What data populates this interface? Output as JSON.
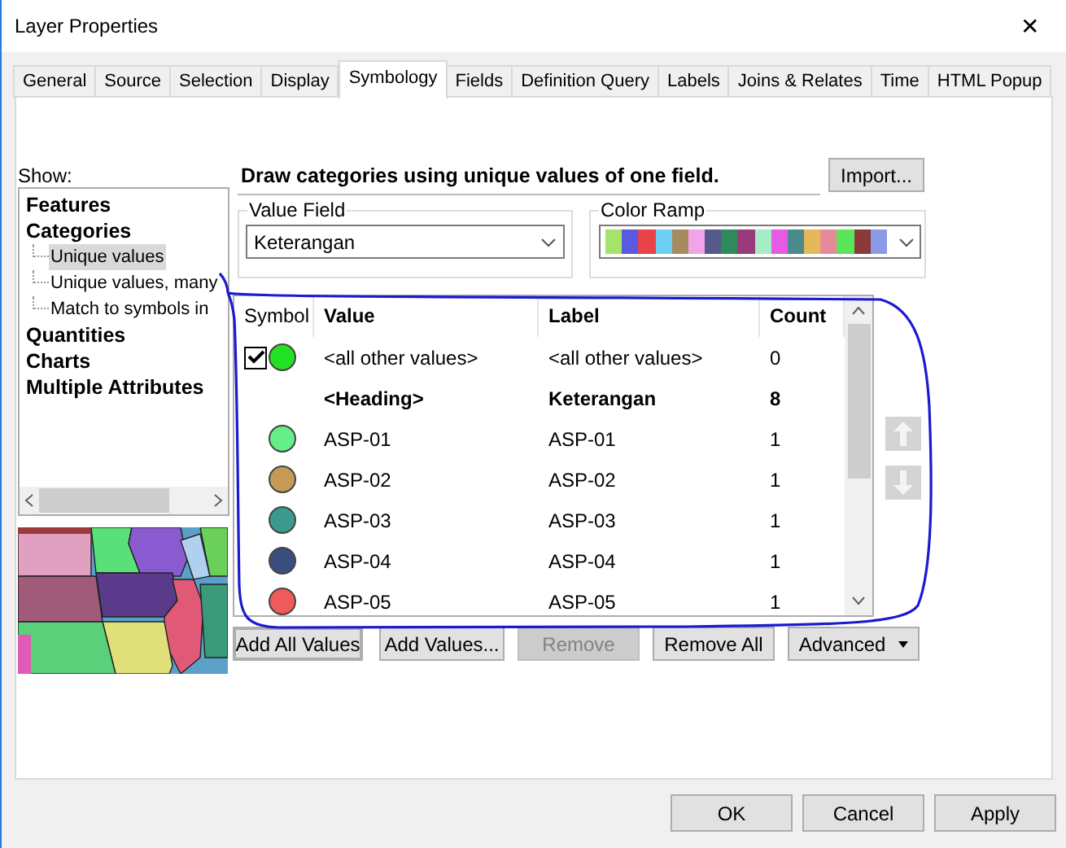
{
  "window": {
    "title": "Layer Properties",
    "close": "✕"
  },
  "tabs": [
    {
      "label": "General",
      "selected": false
    },
    {
      "label": "Source",
      "selected": false
    },
    {
      "label": "Selection",
      "selected": false
    },
    {
      "label": "Display",
      "selected": false
    },
    {
      "label": "Symbology",
      "selected": true
    },
    {
      "label": "Fields",
      "selected": false
    },
    {
      "label": "Definition Query",
      "selected": false
    },
    {
      "label": "Labels",
      "selected": false
    },
    {
      "label": "Joins & Relates",
      "selected": false
    },
    {
      "label": "Time",
      "selected": false
    },
    {
      "label": "HTML Popup",
      "selected": false
    }
  ],
  "show": {
    "label": "Show:",
    "items": [
      {
        "label": "Features",
        "selected": false
      },
      {
        "label": "Categories",
        "selected": false,
        "children": [
          {
            "label": "Unique values",
            "selected": true
          },
          {
            "label": "Unique values, many",
            "selected": false
          },
          {
            "label": "Match to symbols in",
            "selected": false
          }
        ]
      },
      {
        "label": "Quantities",
        "selected": false
      },
      {
        "label": "Charts",
        "selected": false
      },
      {
        "label": "Multiple Attributes",
        "selected": false
      }
    ]
  },
  "description": "Draw categories using unique values of one field.",
  "import_button": "Import...",
  "value_field": {
    "label": "Value Field",
    "value": "Keterangan"
  },
  "color_ramp": {
    "label": "Color Ramp",
    "swatches": [
      {
        "color": "#a6e36a"
      },
      {
        "color": "#5a5ae0"
      },
      {
        "color": "#e8434a"
      },
      {
        "color": "#6ecff5"
      },
      {
        "color": "#a88a60"
      },
      {
        "color": "#f3a4e8"
      },
      {
        "color": "#555a8a"
      },
      {
        "color": "#2e8a5a"
      },
      {
        "color": "#9a3a7a"
      },
      {
        "color": "#a6ecc6"
      },
      {
        "color": "#e65ae6"
      },
      {
        "color": "#4a8a8a"
      },
      {
        "color": "#e6b85a"
      },
      {
        "color": "#e68a9a"
      },
      {
        "color": "#5ae65a"
      },
      {
        "color": "#8a3a3a"
      },
      {
        "color": "#8a9ae6"
      }
    ]
  },
  "table": {
    "columns": [
      "Symbol",
      "Value",
      "Label",
      "Count"
    ],
    "rows": [
      {
        "kind": "other",
        "checked": true,
        "color": "#22e022",
        "value": "<all other values>",
        "label": "<all other values>",
        "count": "0"
      },
      {
        "kind": "heading",
        "value": "<Heading>",
        "label": "Keterangan",
        "count": "8"
      },
      {
        "kind": "value",
        "color": "#66ee88",
        "value": "ASP-01",
        "label": "ASP-01",
        "count": "1"
      },
      {
        "kind": "value",
        "color": "#c49a55",
        "value": "ASP-02",
        "label": "ASP-02",
        "count": "1"
      },
      {
        "kind": "value",
        "color": "#3a9a90",
        "value": "ASP-03",
        "label": "ASP-03",
        "count": "1"
      },
      {
        "kind": "value",
        "color": "#3a4e80",
        "value": "ASP-04",
        "label": "ASP-04",
        "count": "1"
      },
      {
        "kind": "value",
        "color": "#f05a5a",
        "value": "ASP-05",
        "label": "ASP-05",
        "count": "1"
      }
    ]
  },
  "action_buttons": [
    {
      "label": "Add All Values",
      "disabled": false
    },
    {
      "label": "Add Values...",
      "disabled": false
    },
    {
      "label": "Remove",
      "disabled": true
    },
    {
      "label": "Remove All",
      "disabled": false
    },
    {
      "label": "Advanced",
      "disabled": false
    }
  ],
  "dialog_buttons": [
    "OK",
    "Cancel",
    "Apply"
  ]
}
